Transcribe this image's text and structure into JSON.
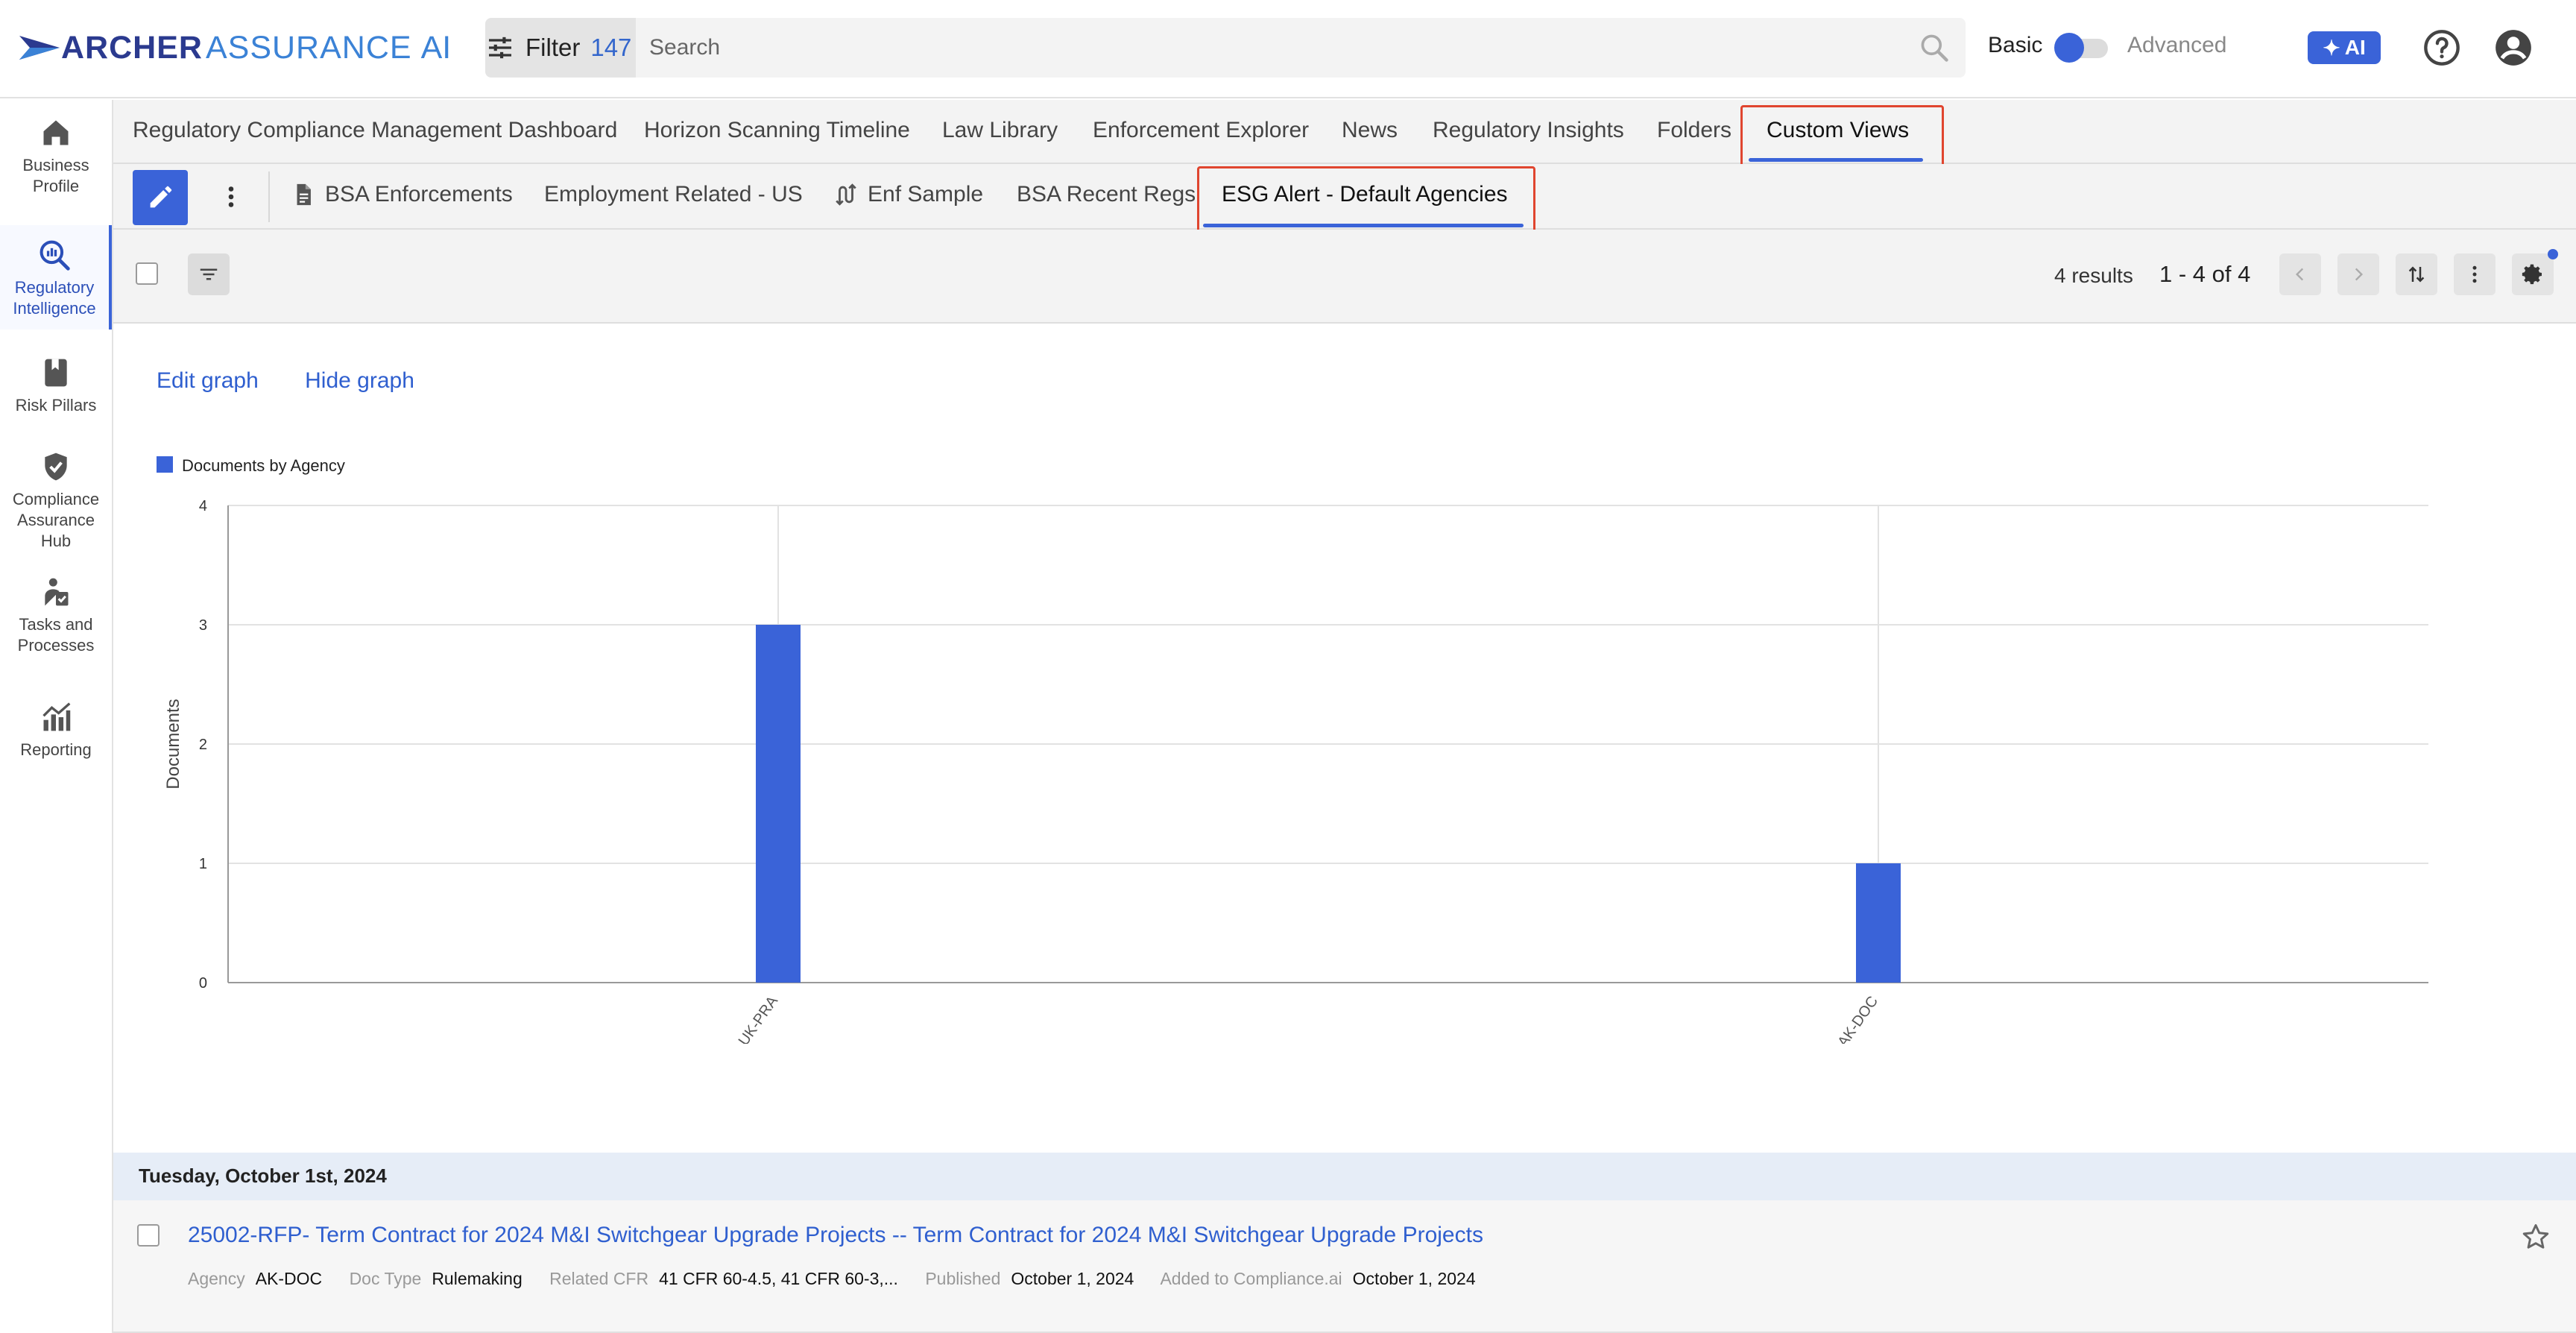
{
  "app": {
    "brand_primary": "ARCHER",
    "brand_secondary": "ASSURANCE",
    "brand_suffix": "AI"
  },
  "topbar": {
    "filter_label": "Filter",
    "filter_count": "147",
    "search_placeholder": "Search",
    "mode_basic": "Basic",
    "mode_advanced": "Advanced",
    "ai_button": "AI"
  },
  "sidebar": {
    "items": [
      {
        "label_line1": "Business",
        "label_line2": "Profile",
        "icon": "home-icon"
      },
      {
        "label_line1": "Regulatory",
        "label_line2": "Intelligence",
        "icon": "search-chart-icon"
      },
      {
        "label_line1": "Risk Pillars",
        "label_line2": "",
        "icon": "bookmark-icon"
      },
      {
        "label_line1": "Compliance",
        "label_line2": "Assurance",
        "label_line3": "Hub",
        "icon": "shield-check-icon"
      },
      {
        "label_line1": "Tasks and",
        "label_line2": "Processes",
        "icon": "task-icon"
      },
      {
        "label_line1": "Reporting",
        "label_line2": "",
        "icon": "chart-icon"
      }
    ]
  },
  "main_tabs": [
    "Regulatory Compliance Management Dashboard",
    "Horizon Scanning Timeline",
    "Law Library",
    "Enforcement Explorer",
    "News",
    "Regulatory Insights",
    "Folders",
    "Custom Views"
  ],
  "sub_tabs": [
    "BSA Enforcements",
    "Employment Related - US",
    "Enf Sample",
    "BSA Recent Regs",
    "ESG Alert - Default Agencies"
  ],
  "toolbar": {
    "results": "4 results",
    "range": "1 - 4 of 4"
  },
  "graph": {
    "edit_label": "Edit graph",
    "hide_label": "Hide graph"
  },
  "chart_data": {
    "type": "bar",
    "legend": "Documents by Agency",
    "ylabel": "Documents",
    "categories": [
      "UK-PRA",
      "AK-DOC"
    ],
    "values": [
      3,
      1
    ],
    "ylim": [
      0,
      4
    ],
    "yticks": [
      "0",
      "1",
      "2",
      "3",
      "4"
    ],
    "grid": true,
    "legend_position": "top-left",
    "bar_color": "#3a63d8"
  },
  "results": {
    "date_header": "Tuesday, October 1st, 2024",
    "rows": [
      {
        "title": "25002-RFP- Term Contract for 2024 M&I Switchgear Upgrade Projects -- Term Contract for 2024 M&I Switchgear Upgrade Projects",
        "agency_label": "Agency",
        "agency": "AK-DOC",
        "doctype_label": "Doc Type",
        "doctype": "Rulemaking",
        "cfr_label": "Related CFR",
        "cfr": "41 CFR 60-4.5, 41 CFR 60-3,...",
        "published_label": "Published",
        "published": "October 1, 2024",
        "added_label": "Added to Compliance.ai",
        "added": "October 1, 2024"
      }
    ]
  },
  "colors": {
    "accent": "#3a63d8",
    "highlight_box": "#e0452f",
    "link": "#2f5fcf"
  }
}
